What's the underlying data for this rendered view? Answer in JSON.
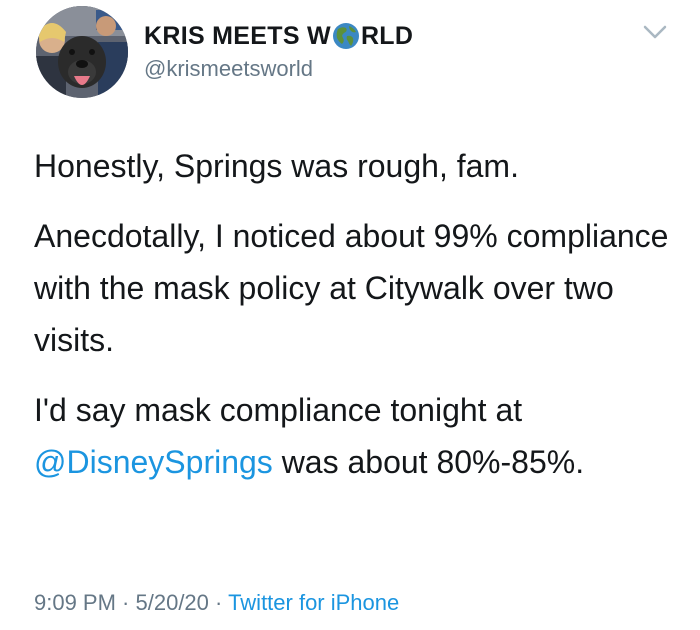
{
  "author": {
    "name_part1": "KRIS MEETS W",
    "name_part2": "RLD",
    "globe_emoji": "globe-americas-icon",
    "handle": "@krismeetsworld"
  },
  "tweet": {
    "paragraph1": "Honestly, Springs was rough, fam.",
    "paragraph2": "Anecdotally, I noticed about 99% compliance with the mask policy at Citywalk over two visits.",
    "paragraph3_before": "I'd say mask compliance tonight at ",
    "paragraph3_mention": "@DisneySprings",
    "paragraph3_after": " was about 80%-85%."
  },
  "meta": {
    "time": "9:09 PM",
    "separator": " · ",
    "date": "5/20/20",
    "source": "Twitter for iPhone"
  },
  "colors": {
    "text": "#14171a",
    "secondary": "#657786",
    "link": "#1b95e0"
  }
}
